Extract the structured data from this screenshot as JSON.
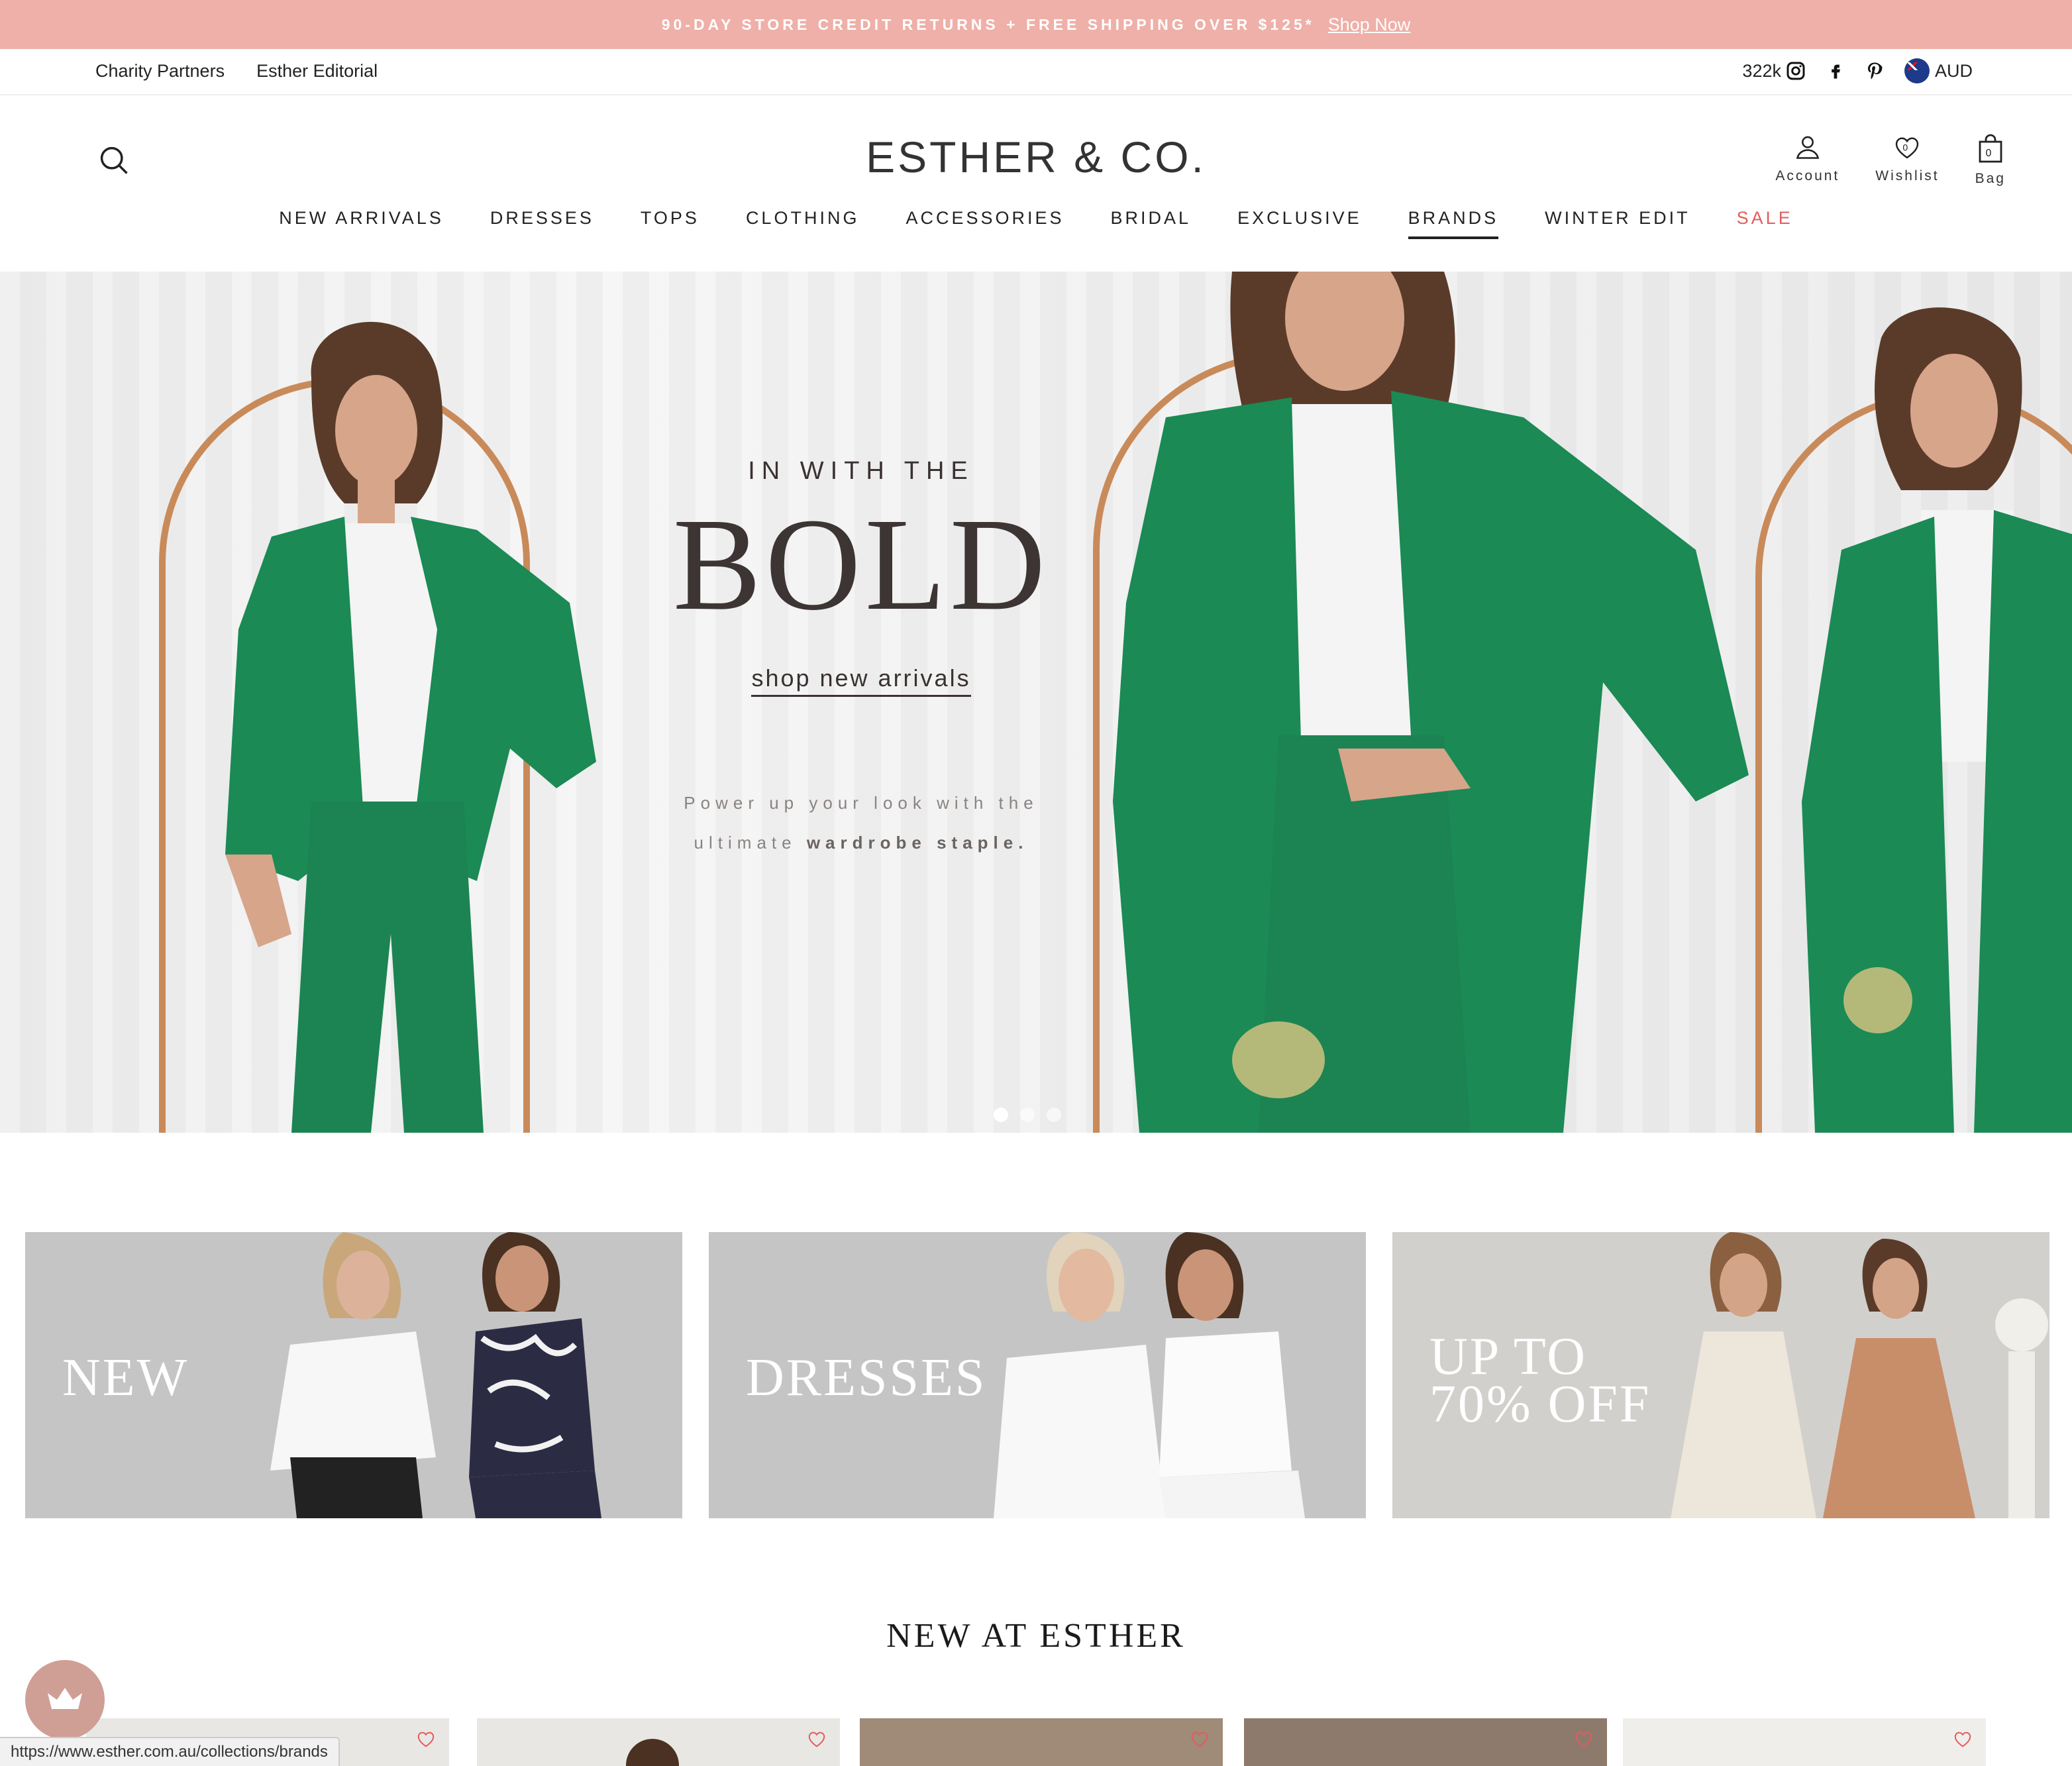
{
  "announcement": {
    "text": "90-DAY STORE CREDIT RETURNS + FREE SHIPPING OVER $125*",
    "link": "Shop Now"
  },
  "utility": {
    "links": [
      "Charity Partners",
      "Esther Editorial"
    ],
    "followers": "322k",
    "currency": "AUD"
  },
  "header": {
    "logo": "ESTHER & CO.",
    "account": "Account",
    "wishlist": "Wishlist",
    "wishlist_count": "0",
    "bag": "Bag",
    "bag_count": "0"
  },
  "nav": {
    "items": [
      "NEW ARRIVALS",
      "DRESSES",
      "TOPS",
      "CLOTHING",
      "ACCESSORIES",
      "BRIDAL",
      "EXCLUSIVE",
      "BRANDS",
      "WINTER EDIT",
      "SALE"
    ],
    "active": "BRANDS"
  },
  "hero": {
    "pre": "IN WITH THE",
    "big": "BOLD",
    "cta": "shop new arrivals",
    "sub_line1": "Power up your look with the",
    "sub_line2_plain": "ultimate",
    "sub_line2_bold": "wardrobe staple.",
    "slides": 3,
    "current_slide": 1
  },
  "tiles": [
    {
      "label": "NEW"
    },
    {
      "label": "DRESSES"
    },
    {
      "label_line1": "UP TO",
      "label_line2": "70% OFF"
    }
  ],
  "section": {
    "title": "NEW AT ESTHER"
  },
  "status_url": "https://www.esther.com.au/collections/brands",
  "colors": {
    "announcement_bg": "#eeb0a8",
    "sale": "#e25c5c",
    "suit_green": "#1b8a55",
    "rewards_button": "#cf9e95"
  }
}
